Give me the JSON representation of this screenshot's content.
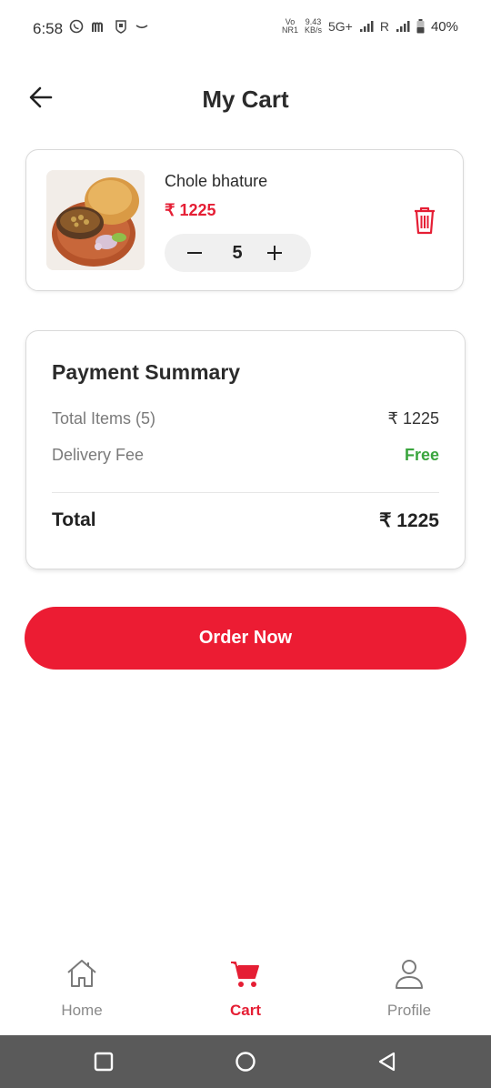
{
  "status_bar": {
    "time": "6:58",
    "network_speed_top": "9.43",
    "network_speed_bottom": "KB/s",
    "volte_top": "Vo",
    "volte_bottom": "NR1",
    "network_type": "5G+",
    "roaming": "R",
    "battery": "40%"
  },
  "header": {
    "title": "My Cart"
  },
  "cart_item": {
    "name": "Chole bhature",
    "price": "₹ 1225",
    "quantity": "5"
  },
  "payment_summary": {
    "title": "Payment Summary",
    "items_label": "Total Items (5)",
    "items_value": "₹ 1225",
    "delivery_label": "Delivery Fee",
    "delivery_value": "Free",
    "total_label": "Total",
    "total_value": "₹ 1225"
  },
  "order_button": {
    "label": "Order Now"
  },
  "bottom_nav": {
    "items": [
      {
        "label": "Home",
        "icon": "home-icon"
      },
      {
        "label": "Cart",
        "icon": "cart-icon"
      },
      {
        "label": "Profile",
        "icon": "profile-icon"
      }
    ],
    "active": "Cart"
  },
  "colors": {
    "accent": "#e51e34",
    "button": "#ec1c33",
    "free": "#3aa53e"
  }
}
